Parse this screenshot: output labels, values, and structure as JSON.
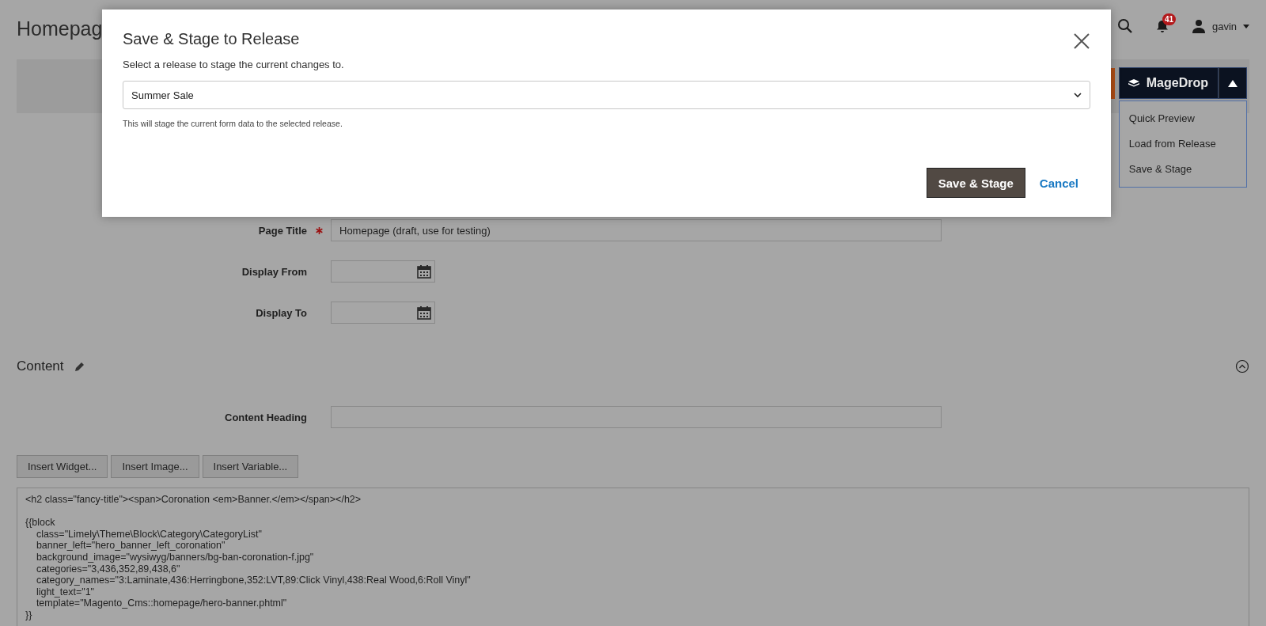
{
  "page": {
    "title": "Homepag"
  },
  "header": {
    "notifications": "41",
    "user": "gavin"
  },
  "magedrop": {
    "label": "MageDrop",
    "menu": [
      "Quick Preview",
      "Load from Release",
      "Save & Stage"
    ]
  },
  "form": {
    "fields": [
      {
        "label": "Page Title",
        "required": true,
        "kind": "text",
        "value": "Homepage (draft, use for testing)"
      },
      {
        "label": "Display From",
        "required": false,
        "kind": "date"
      },
      {
        "label": "Display To",
        "required": false,
        "kind": "date"
      }
    ]
  },
  "content": {
    "title": "Content",
    "heading_label": "Content Heading",
    "buttons": [
      "Insert Widget...",
      "Insert Image...",
      "Insert Variable..."
    ],
    "editor_blocks": [
      [
        "<h2 class=\"fancy-title\"><span>Coronation <em>Banner.</em></span></h2>"
      ],
      [
        "{{block",
        "    class=\"Limely\\Theme\\Block\\Category\\CategoryList\"",
        "    banner_left=\"hero_banner_left_coronation\"",
        "    background_image=\"wysiwyg/banners/bg-ban-coronation-f.jpg\"",
        "    categories=\"3,436,352,89,438,6\"",
        "    category_names=\"3:Laminate,436:Herringbone,352:LVT,89:Click Vinyl,438:Real Wood,6:Roll Vinyl\"",
        "    light_text=\"1\"",
        "    template=\"Magento_Cms::homepage/hero-banner.phtml\"",
        "}}"
      ]
    ]
  },
  "modal": {
    "title": "Save & Stage to Release",
    "prompt": "Select a release to stage the current changes to.",
    "release": "Summer Sale",
    "note": "This will stage the current form data to the selected release.",
    "primary": "Save & Stage",
    "cancel": "Cancel"
  }
}
